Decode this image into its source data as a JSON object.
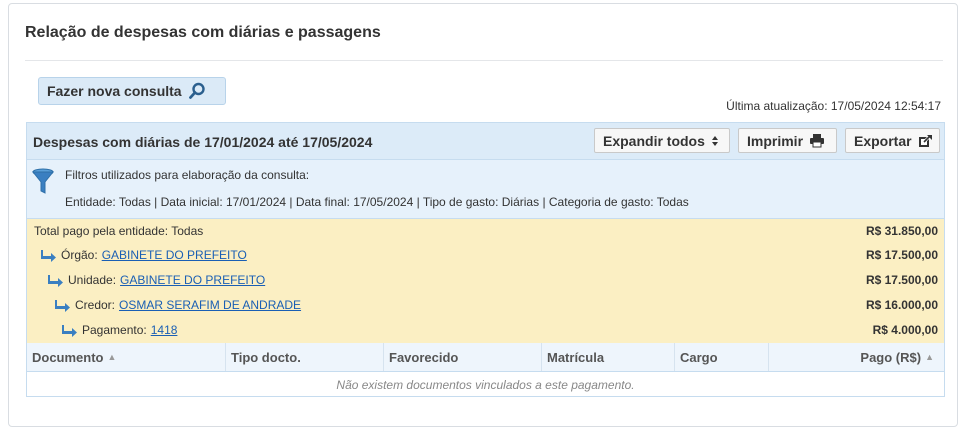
{
  "page": {
    "title": "Relação de despesas com diárias e passagens",
    "new_query_label": "Fazer nova consulta",
    "last_update": "Última atualização: 17/05/2024 12:54:17"
  },
  "results": {
    "title": "Despesas com diárias de 17/01/2024 até 17/05/2024",
    "expand_all_label": "Expandir todos",
    "print_label": "Imprimir",
    "export_label": "Exportar"
  },
  "filters": {
    "label": "Filtros utilizados para elaboração da consulta:",
    "text": "Entidade: Todas | Data inicial: 17/01/2024 | Data final: 17/05/2024 | Tipo de gasto: Diárias | Categoria de gasto: Todas"
  },
  "tree": {
    "total": {
      "label": "Total pago pela entidade: Todas",
      "amount": "R$ 31.850,00"
    },
    "orgao": {
      "label": "Órgão:",
      "link": "GABINETE DO PREFEITO",
      "amount": "R$ 17.500,00"
    },
    "unidade": {
      "label": "Unidade:",
      "link": "GABINETE DO PREFEITO",
      "amount": "R$ 17.500,00"
    },
    "credor": {
      "label": "Credor:",
      "link": "OSMAR SERAFIM DE ANDRADE",
      "amount": "R$ 16.000,00"
    },
    "pagamento": {
      "label": "Pagamento:",
      "link": "1418",
      "amount": "R$ 4.000,00"
    }
  },
  "table": {
    "columns": [
      "Documento",
      "Tipo docto.",
      "Favorecido",
      "Matrícula",
      "Cargo",
      "Pago (R$)"
    ],
    "empty_message": "Não existem documentos vinculados a este pagamento."
  },
  "colors": {
    "header_bg": "#dcebf8",
    "filters_bg": "#e6f1fb",
    "tree_bg": "#fbefc3",
    "link": "#1a5fb4",
    "icon_blue": "#3a7fc1"
  },
  "icons": {
    "search": "search-icon",
    "sort": "sort-icon",
    "print": "printer-icon",
    "export": "export-icon",
    "filter": "filter-funnel-icon",
    "tree_arrow": "arrow-return-icon"
  }
}
